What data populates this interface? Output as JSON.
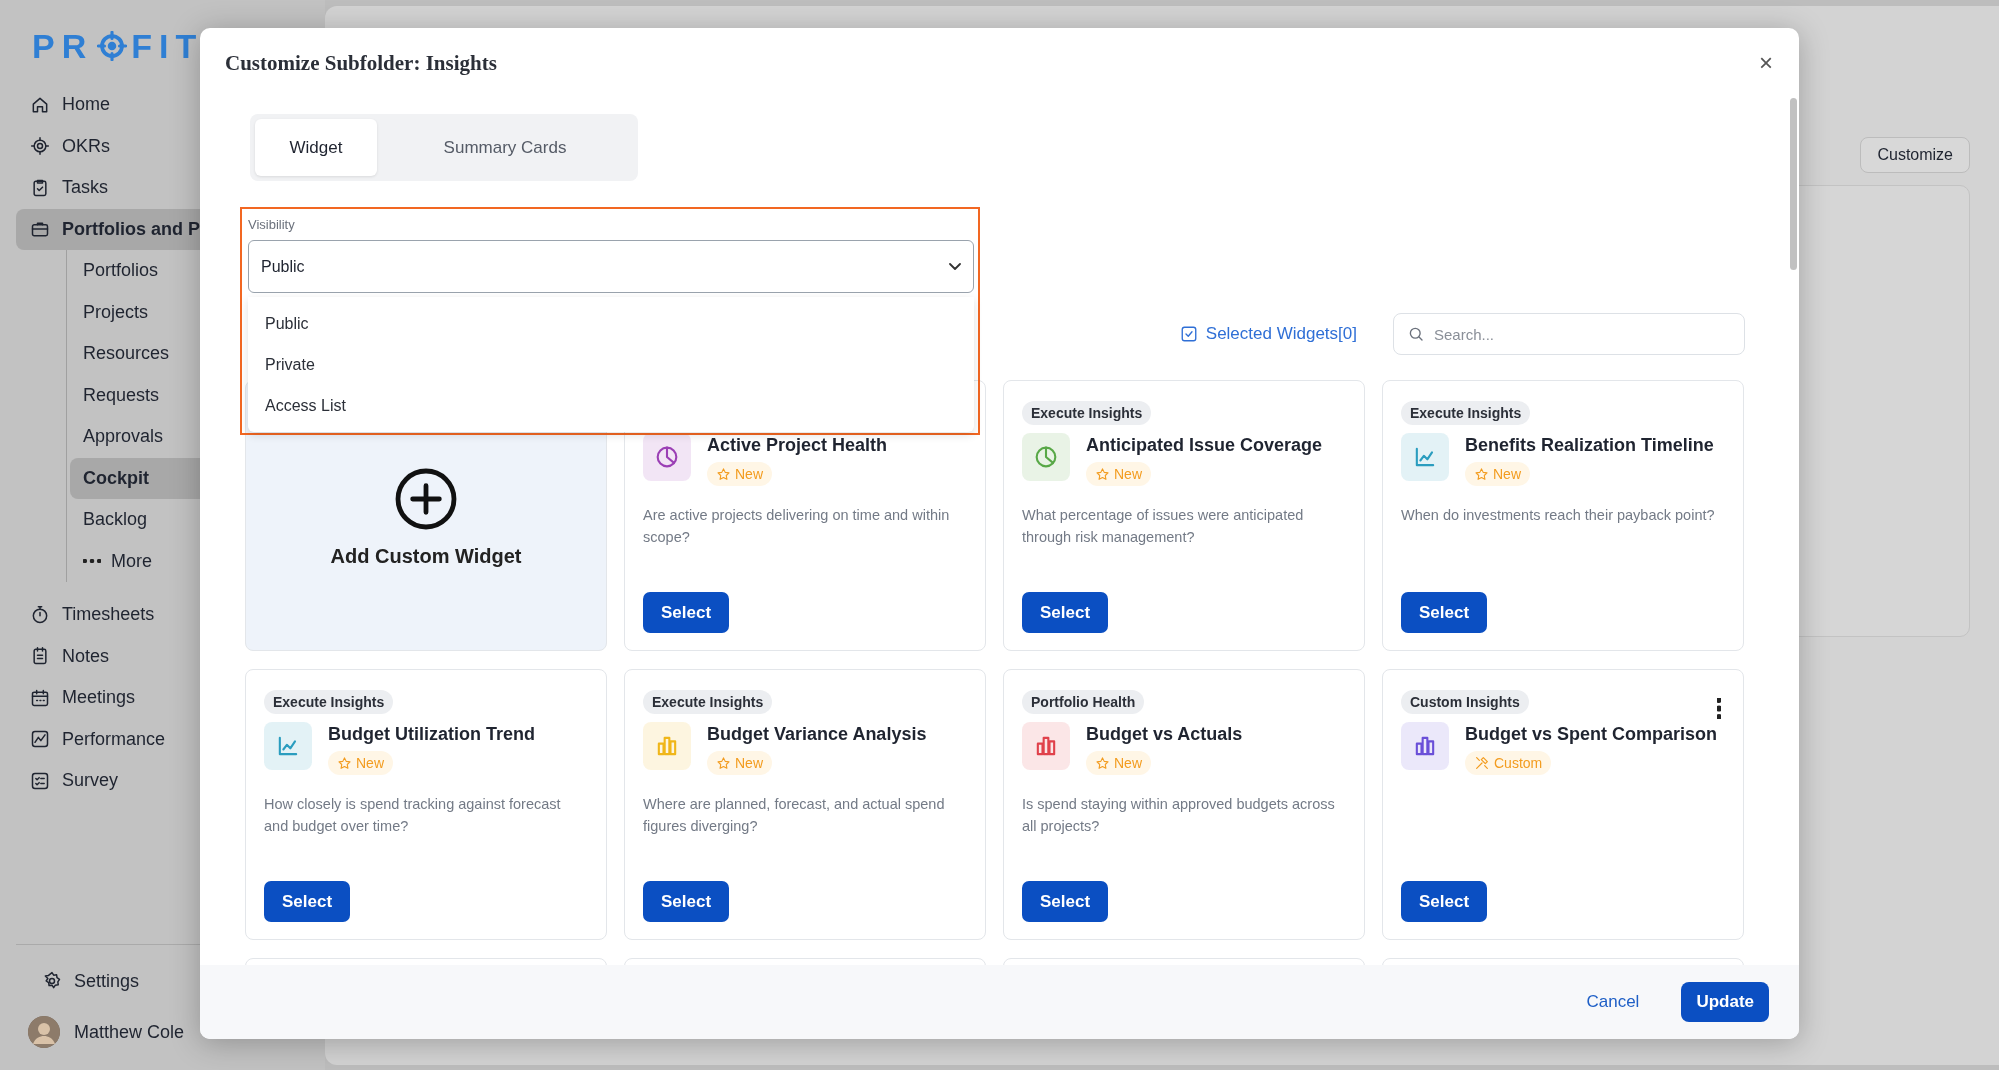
{
  "sidebar": {
    "logo": {
      "left": "PR",
      "right": "FIT"
    },
    "nav": [
      {
        "label": "Home",
        "selected": false
      },
      {
        "label": "OKRs",
        "selected": false
      },
      {
        "label": "Tasks",
        "selected": false
      },
      {
        "label": "Portfolios and P",
        "selected": true,
        "children": [
          {
            "label": "Portfolios",
            "selected": false
          },
          {
            "label": "Projects",
            "selected": false
          },
          {
            "label": "Resources",
            "selected": false
          },
          {
            "label": "Requests",
            "selected": false
          },
          {
            "label": "Approvals",
            "selected": false
          },
          {
            "label": "Cockpit",
            "selected": true
          },
          {
            "label": "Backlog",
            "selected": false
          },
          {
            "label": "More",
            "selected": false,
            "kind": "more"
          }
        ]
      },
      {
        "label": "Timesheets",
        "selected": false
      },
      {
        "label": "Notes",
        "selected": false
      },
      {
        "label": "Meetings",
        "selected": false
      },
      {
        "label": "Performance",
        "selected": false
      },
      {
        "label": "Survey",
        "selected": false
      }
    ],
    "settings": "Settings",
    "user": "Matthew Cole"
  },
  "main": {
    "customize_button": "Customize"
  },
  "modal": {
    "title": "Customize Subfolder: Insights",
    "close": "×",
    "tabs": [
      {
        "label": "Widget",
        "selected": true
      },
      {
        "label": "Summary Cards",
        "selected": false
      }
    ],
    "visibility": {
      "label": "Visibility",
      "value": "Public",
      "expanded": true,
      "options": [
        "Public",
        "Private",
        "Access List"
      ]
    },
    "selected_widgets": "Selected Widgets[0]",
    "search": {
      "placeholder": "Search..."
    },
    "cards": [
      {
        "kind": "add",
        "title": "Add Custom Widget"
      },
      {
        "kind": "widget",
        "title": "Active Project Health",
        "color": "#9b3fb5",
        "badge": {
          "kind": "new",
          "label": "New"
        },
        "description": "Are active projects delivering on time and within scope?",
        "button": "Select"
      },
      {
        "kind": "widget",
        "tag": "Execute Insights",
        "title": "Anticipated Issue Coverage",
        "color": "#58a847",
        "badge": {
          "kind": "new",
          "label": "New"
        },
        "description": "What percentage of issues were anticipated through risk management?",
        "button": "Select"
      },
      {
        "kind": "widget",
        "tag": "Execute Insights",
        "title": "Benefits Realization Timeline",
        "color": "#2a9dbf",
        "badge": {
          "kind": "new",
          "label": "New"
        },
        "description": "When do investments reach their payback point?",
        "button": "Select"
      },
      {
        "kind": "widget",
        "tag": "Execute Insights",
        "title": "Budget Utilization Trend",
        "color": "#2a9dbf",
        "badge": {
          "kind": "new",
          "label": "New"
        },
        "description": "How closely is spend tracking against forecast and budget over time?",
        "button": "Select"
      },
      {
        "kind": "widget",
        "tag": "Execute Insights",
        "title": "Budget Variance Analysis",
        "color": "#f0b619",
        "badge": {
          "kind": "new",
          "label": "New"
        },
        "description": "Where are planned, forecast, and actual spend figures diverging?",
        "button": "Select"
      },
      {
        "kind": "widget",
        "tag": "Portfolio Health",
        "title": "Budget vs Actuals",
        "color": "#e0414b",
        "badge": {
          "kind": "new",
          "label": "New"
        },
        "description": "Is spend staying within approved budgets across all projects?",
        "button": "Select"
      },
      {
        "kind": "widget",
        "tag": "Custom Insights",
        "title": "Budget vs Spent Comparison",
        "color": "#6a4fd8",
        "badge": {
          "kind": "custom",
          "label": "Custom"
        },
        "menu": true,
        "button": "Select"
      },
      {
        "kind": "cut_off"
      },
      {
        "kind": "cut_off"
      },
      {
        "kind": "cut_off"
      },
      {
        "kind": "cut_off"
      }
    ],
    "footer": {
      "cancel": "Cancel",
      "update": "Update"
    }
  }
}
